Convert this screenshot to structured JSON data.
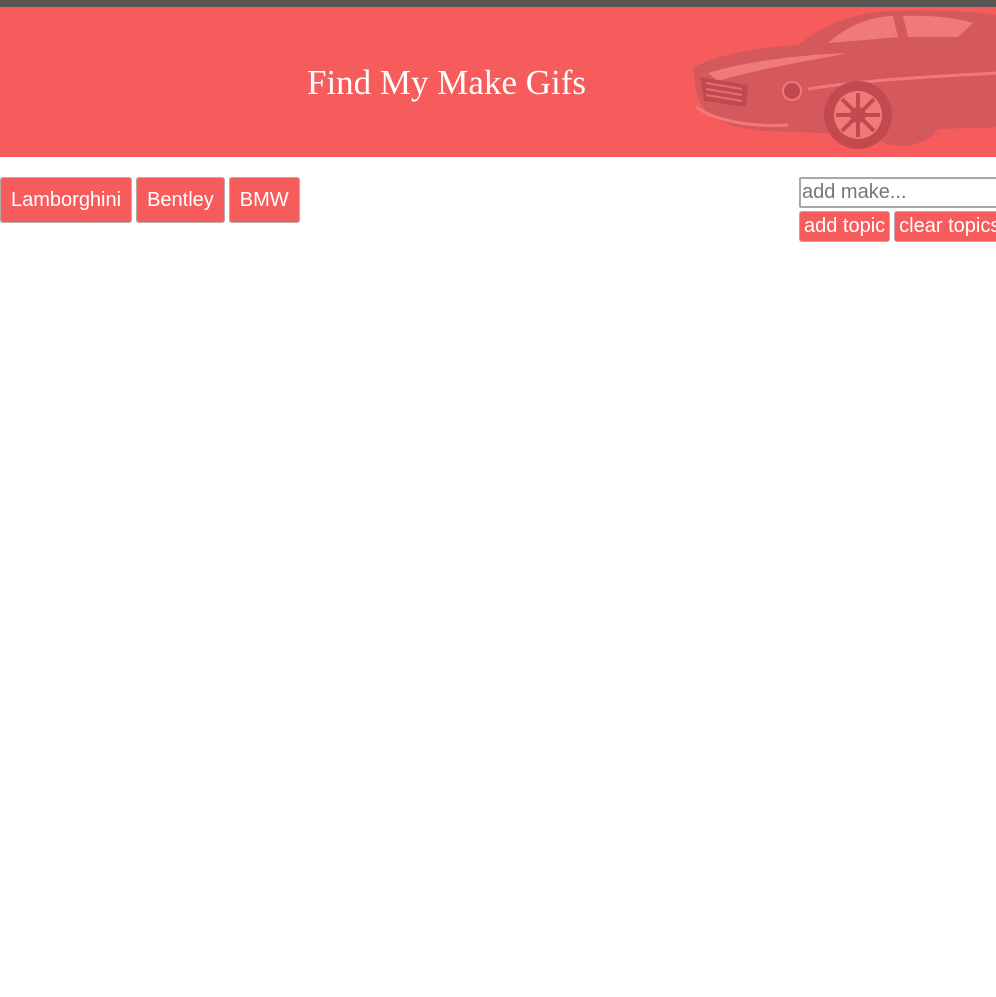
{
  "header": {
    "title": "Find My Make Gifs",
    "background_color": "#f65c5c",
    "car_icon": "classic-muscle-car"
  },
  "topics": [
    {
      "label": "Lamborghini"
    },
    {
      "label": "Bentley"
    },
    {
      "label": "BMW"
    }
  ],
  "form": {
    "input_placeholder": "add make...",
    "input_value": "",
    "add_label": "add topic",
    "clear_label": "clear topics"
  }
}
